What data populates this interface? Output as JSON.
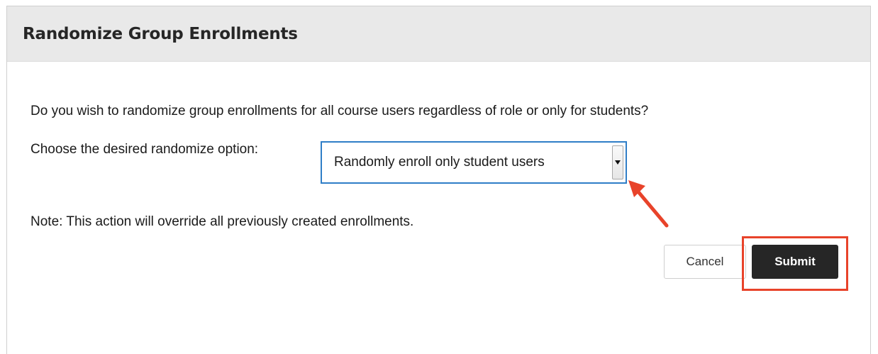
{
  "dialog": {
    "title": "Randomize Group Enrollments",
    "question": "Do you wish to randomize group enrollments for all course users regardless of role or only for students?",
    "option_label": "Choose the desired randomize option:",
    "select": {
      "selected_value": "Randomly enroll only student users",
      "arrow_icon": "triangle-down-icon"
    },
    "note": "Note: This action will override all previously created enrollments.",
    "buttons": {
      "cancel_label": "Cancel",
      "submit_label": "Submit"
    }
  },
  "annotations": {
    "color": "#e8432a",
    "arrow_icon": "red-pointer-arrow",
    "highlight": "red-rectangle-around-submit"
  },
  "colors": {
    "header_bg": "#e9e9e9",
    "select_border": "#2f7ec7",
    "submit_bg": "#262626"
  }
}
